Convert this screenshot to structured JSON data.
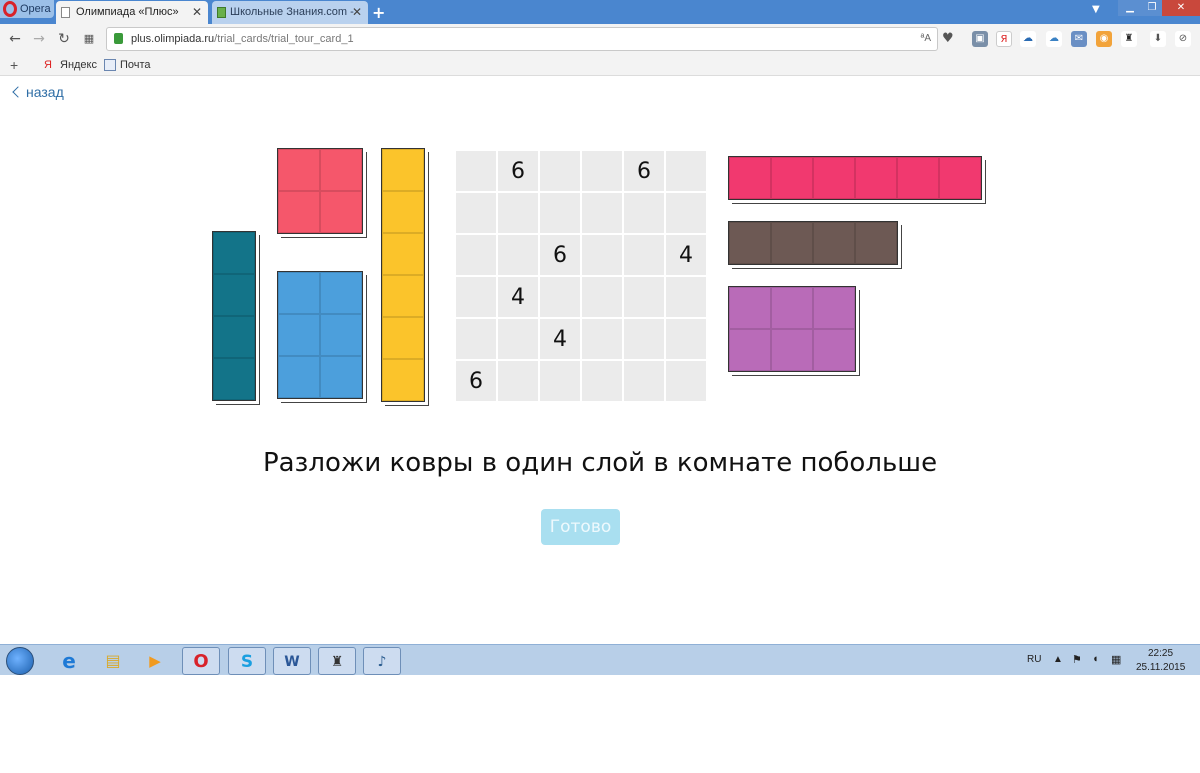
{
  "browser": {
    "menu_label": "Opera",
    "tabs": [
      {
        "label": "Олимпиада «Плюс»",
        "active": true
      },
      {
        "label": "Школьные Знания.com -",
        "active": false
      }
    ],
    "url": {
      "host": "plus.olimpiada.ru",
      "path": "/trial_cards/trial_tour_card_1"
    },
    "bookmarks": [
      {
        "label": "Яндекс",
        "icon": "yandex-icon"
      },
      {
        "label": "Почта",
        "icon": "mail-icon"
      }
    ]
  },
  "page": {
    "back_label": "назад",
    "task_text": "Разложи ковры в один слой в комнате побольше",
    "done_label": "Готово"
  },
  "rugs": [
    {
      "id": "teal-1x4",
      "color": "#137489",
      "cols": 1,
      "rows": 4
    },
    {
      "id": "red-2x2",
      "color": "#f5576b",
      "cols": 2,
      "rows": 2
    },
    {
      "id": "blue-2x3",
      "color": "#4c9fdc",
      "cols": 2,
      "rows": 3
    },
    {
      "id": "yellow-1x6",
      "color": "#fbc42b",
      "cols": 1,
      "rows": 6
    },
    {
      "id": "pink-6x1",
      "color": "#f1396f",
      "cols": 6,
      "rows": 1
    },
    {
      "id": "brown-4x1",
      "color": "#6d5954",
      "cols": 4,
      "rows": 1
    },
    {
      "id": "purple-3x2",
      "color": "#b96bb8",
      "cols": 3,
      "rows": 2
    }
  ],
  "room": {
    "size": 6,
    "grid": [
      [
        "",
        "6",
        "",
        "",
        "6",
        ""
      ],
      [
        "",
        "",
        "",
        "",
        "",
        ""
      ],
      [
        "",
        "",
        "6",
        "",
        "",
        "4"
      ],
      [
        "",
        "4",
        "",
        "",
        "",
        ""
      ],
      [
        "",
        "",
        "4",
        "",
        "",
        ""
      ],
      [
        "6",
        "",
        "",
        "",
        "",
        ""
      ]
    ]
  },
  "taskbar": {
    "language": "RU",
    "time": "22:25",
    "date": "25.11.2015",
    "apps": [
      "internet-explorer-icon",
      "file-explorer-icon",
      "media-player-icon",
      "opera-icon",
      "skype-icon",
      "word-icon",
      "world-of-tanks-icon",
      "other-app-icon"
    ]
  }
}
